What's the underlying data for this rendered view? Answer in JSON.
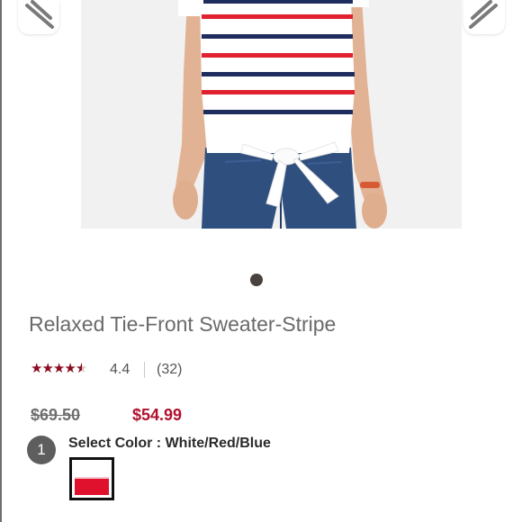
{
  "product": {
    "title": "Relaxed Tie-Front Sweater-Stripe",
    "rating_value": "4.4",
    "rating_stars": 4.4,
    "review_count": "(32)",
    "price_original": "$69.50",
    "price_sale": "$54.99"
  },
  "carousel": {
    "slide_count": 1,
    "active_index": 0
  },
  "color_selector": {
    "step_number": "1",
    "label": "Select Color : White/Red/Blue",
    "selected_swatch": "White/Red/Blue"
  },
  "icons": {
    "prev": "chevron-left-icon",
    "next": "chevron-right-icon",
    "star": "star-icon"
  },
  "colors": {
    "star": "#8b0a1e",
    "sale_price": "#b0112e",
    "stripe_red": "#e0212f",
    "stripe_navy": "#1f2d5e",
    "badge": "#5e5e5e"
  }
}
